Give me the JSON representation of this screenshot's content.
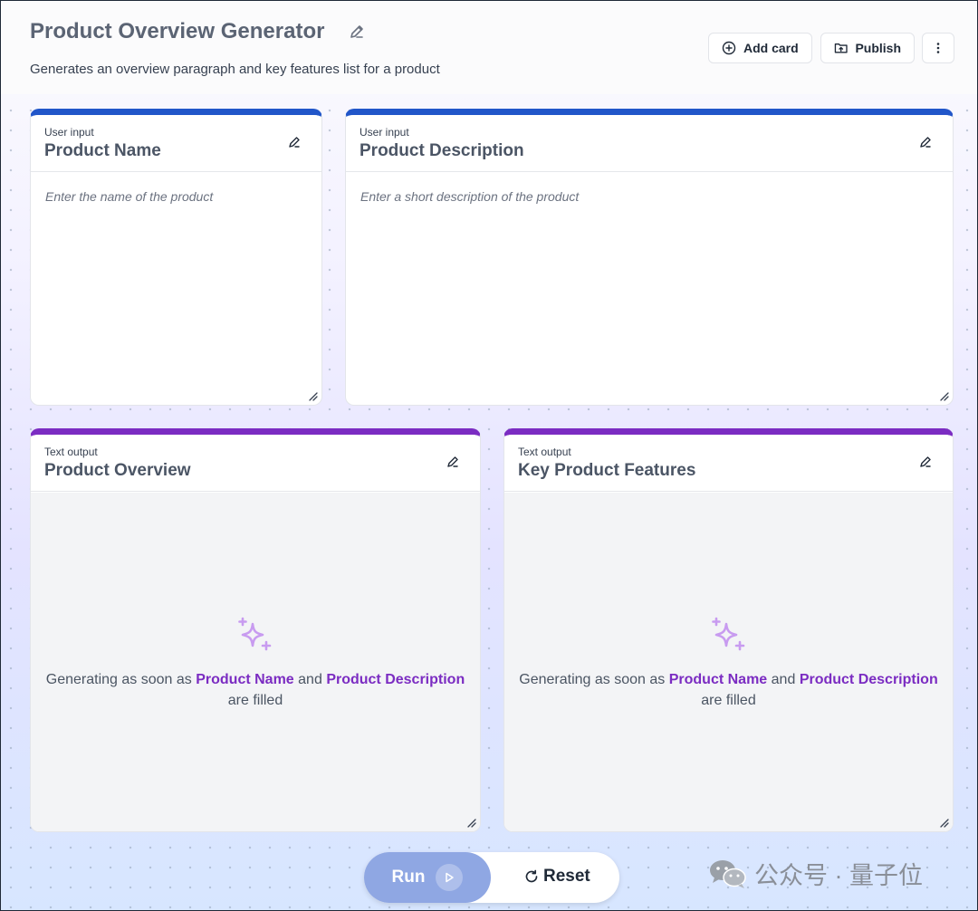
{
  "header": {
    "title": "Product Overview Generator",
    "subtitle": "Generates an overview paragraph and key features list for a product",
    "add_card_label": "Add card",
    "publish_label": "Publish"
  },
  "cards": [
    {
      "type": "User input",
      "title": "Product Name",
      "placeholder": "Enter the name of the product"
    },
    {
      "type": "User input",
      "title": "Product Description",
      "placeholder": "Enter a short description of the product"
    },
    {
      "type": "Text output",
      "title": "Product Overview",
      "gen_prefix": "Generating as soon as",
      "dep1": "Product Name",
      "and": "and",
      "dep2": "Product Description",
      "gen_suffix": "are filled"
    },
    {
      "type": "Text output",
      "title": "Key Product Features",
      "gen_prefix": "Generating as soon as",
      "dep1": "Product Name",
      "and": "and",
      "dep2": "Product Description",
      "gen_suffix": "are filled"
    }
  ],
  "actions": {
    "run_label": "Run",
    "reset_label": "Reset"
  },
  "watermark": {
    "text": "公众号 · 量子位"
  },
  "colors": {
    "input_accent": "#2156c9",
    "output_accent": "#7b2cc2",
    "run_button": "#8fa7e3"
  },
  "icons": [
    "pencil-icon",
    "plus-circle-icon",
    "folder-upload-icon",
    "more-vertical-icon",
    "sparkle-icon",
    "play-icon",
    "refresh-icon",
    "resize-handle-icon",
    "wechat-icon"
  ]
}
